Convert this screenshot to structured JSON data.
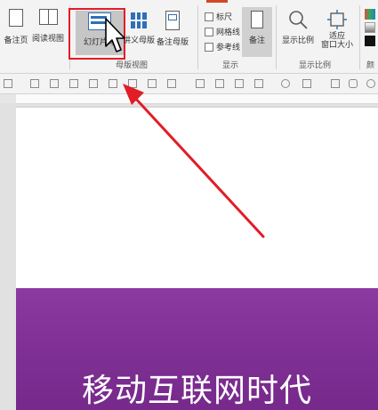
{
  "ribbon": {
    "view_group": {
      "notes_page": "备注页",
      "reading_view": "阅读视图",
      "slide_master": "幻灯片母",
      "handout_master": "讲义母版",
      "notes_master": "备注母版",
      "group_label": "母版视图"
    },
    "show_group": {
      "ruler": "标尺",
      "gridlines": "网格线",
      "guides": "参考线",
      "notes": "备注",
      "group_label": "显示"
    },
    "zoom_group": {
      "zoom": "显示比例",
      "fit_window": "适应\n窗口大小",
      "group_label": "显示比例"
    },
    "color_group": {
      "label_partial": "颜"
    }
  },
  "slide": {
    "title": "移动互联网时代"
  },
  "colors": {
    "highlight": "#e11d27",
    "purple": "#7e2f93",
    "accent_tab": "#d24726"
  }
}
